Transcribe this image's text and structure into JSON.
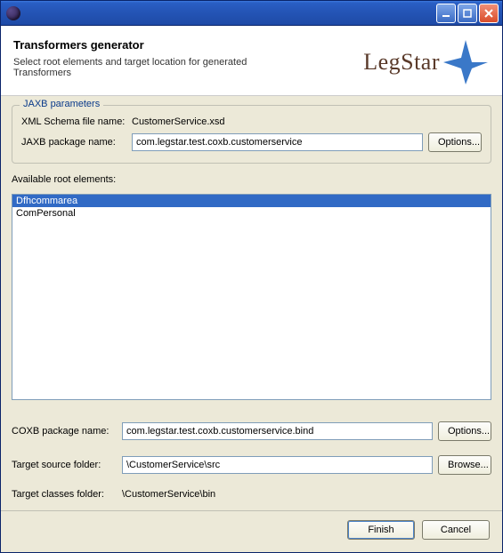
{
  "titlebar": {
    "title": ""
  },
  "header": {
    "title": "Transformers generator",
    "subtitle": "Select root elements and target location for generated Transformers"
  },
  "logo": {
    "text": "LegStar"
  },
  "jaxb": {
    "legend": "JAXB parameters",
    "schema_label": "XML Schema file name:",
    "schema_value": "CustomerService.xsd",
    "package_label": "JAXB package name:",
    "package_value": "com.legstar.test.coxb.customerservice",
    "options_label": "Options..."
  },
  "available_label": "Available root elements:",
  "root_elements": {
    "items": [
      {
        "label": "Dfhcommarea",
        "selected": true
      },
      {
        "label": "ComPersonal",
        "selected": false
      }
    ]
  },
  "coxb": {
    "label": "COXB package name:",
    "value": "com.legstar.test.coxb.customerservice.bind",
    "options_label": "Options..."
  },
  "target_src": {
    "label": "Target source folder:",
    "value": "\\CustomerService\\src",
    "browse_label": "Browse..."
  },
  "target_classes": {
    "label": "Target classes folder:",
    "value": "\\CustomerService\\bin"
  },
  "footer": {
    "finish": "Finish",
    "cancel": "Cancel"
  }
}
